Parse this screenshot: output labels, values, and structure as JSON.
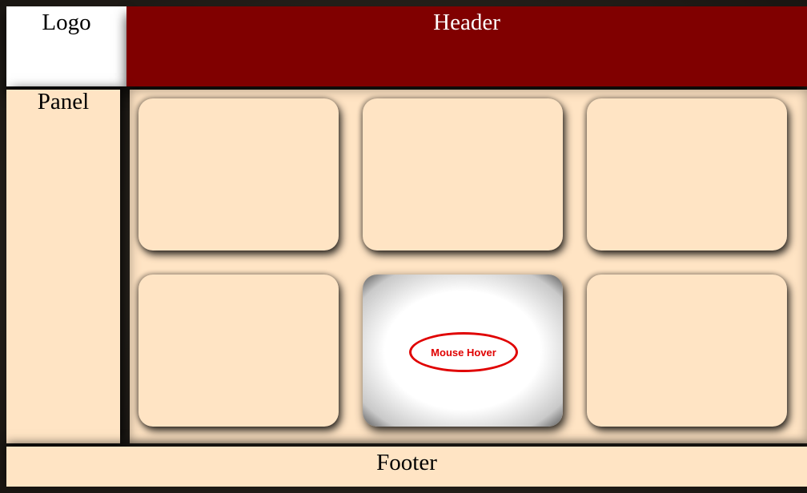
{
  "logo": {
    "label": "Logo"
  },
  "header": {
    "title": "Header"
  },
  "panel": {
    "title": "Panel"
  },
  "footer": {
    "label": "Footer"
  },
  "grid": {
    "hover_label": "Mouse Hover"
  },
  "colors": {
    "header_bg": "#800000",
    "header_text": "#ffffff",
    "panel_bg": "#ffe4c4",
    "card_bg": "#ffe4c4",
    "hover_card_bg": "#ffffff",
    "highlight": "#e00000"
  }
}
